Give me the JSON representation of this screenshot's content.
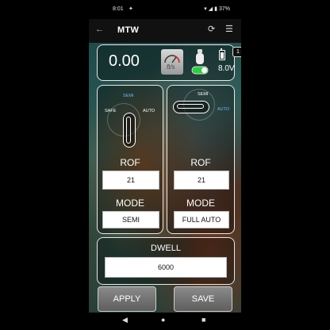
{
  "status_bar": {
    "time": "8:01",
    "battery_percent": "37%"
  },
  "app_bar": {
    "title": "MTW"
  },
  "top_panel": {
    "speed": "0.00",
    "gauge_unit": "ft/s",
    "tank_toggle_on": true,
    "profile_badge": "1",
    "voltage": "8.0V",
    "accent_color": "#2ecc40"
  },
  "left_group": {
    "switch_labels": {
      "safe": "SAFE",
      "semi": "SEMI",
      "auto": "AUTO"
    },
    "switch_active": "SEMI",
    "rof_label": "ROF",
    "rof_value": "21",
    "mode_label": "MODE",
    "mode_value": "SEMI"
  },
  "right_group": {
    "switch_labels": {
      "semi": "SEMI",
      "auto": "AUTO"
    },
    "switch_active": "AUTO",
    "rof_label": "ROF",
    "rof_value": "21",
    "mode_label": "MODE",
    "mode_value": "FULL AUTO"
  },
  "dwell": {
    "label": "DWELL",
    "value": "6000"
  },
  "buttons": {
    "apply": "APPLY",
    "save": "SAVE"
  },
  "colors": {
    "selected_label": "#6fb6ff",
    "panel_border": "#e8e8e8"
  }
}
